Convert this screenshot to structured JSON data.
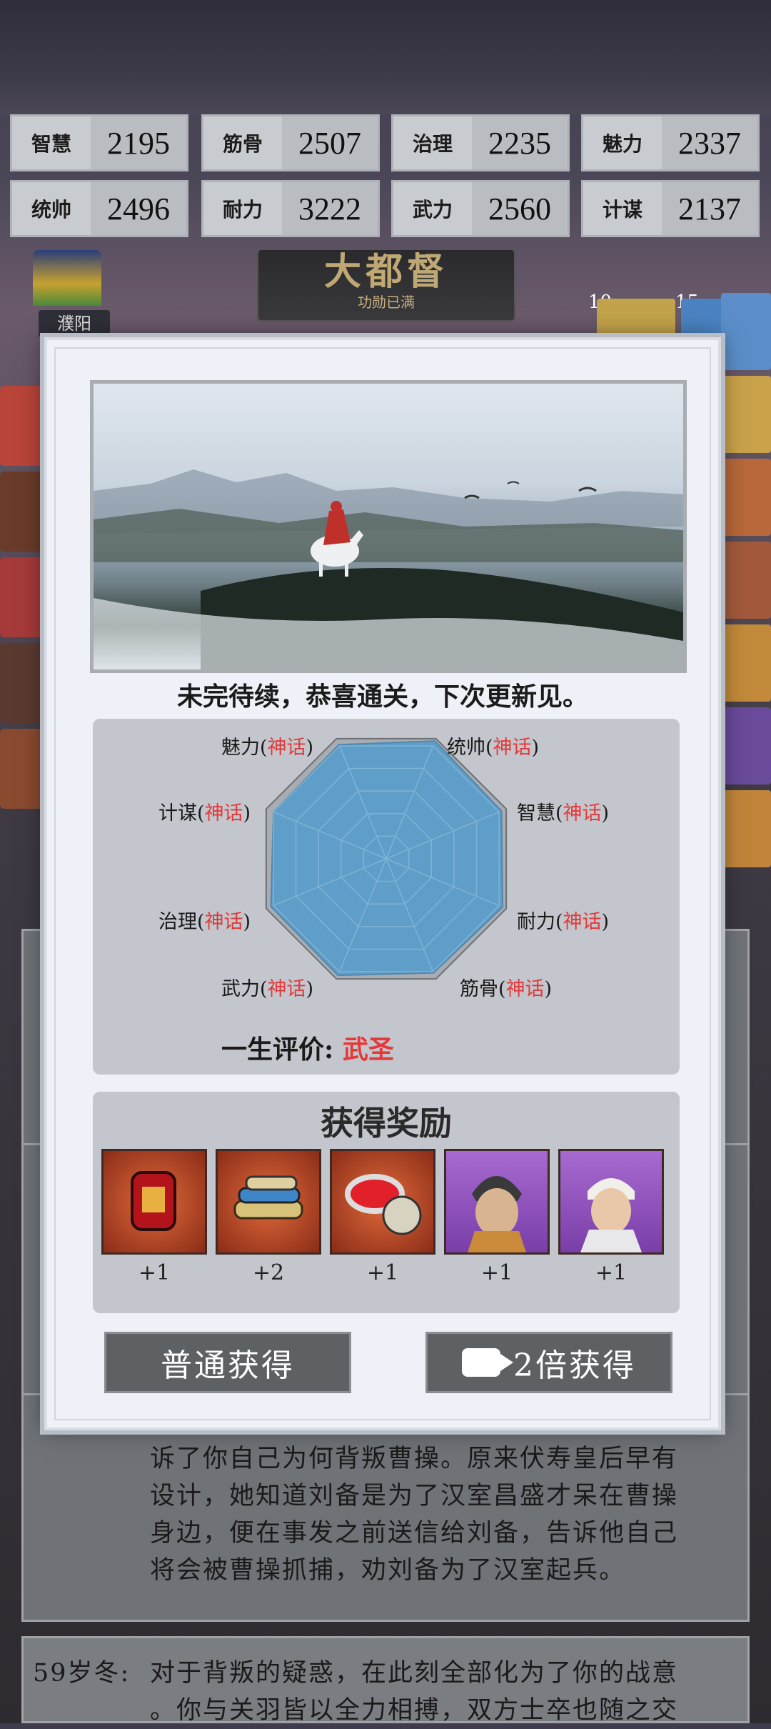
{
  "stats": [
    {
      "label": "智慧",
      "value": "2195"
    },
    {
      "label": "筋骨",
      "value": "2507"
    },
    {
      "label": "治理",
      "value": "2235"
    },
    {
      "label": "魅力",
      "value": "2337"
    },
    {
      "label": "统帅",
      "value": "2496"
    },
    {
      "label": "耐力",
      "value": "3222"
    },
    {
      "label": "武力",
      "value": "2560"
    },
    {
      "label": "计谋",
      "value": "2137"
    }
  ],
  "title": {
    "rank": "大都督",
    "status": "功勋已满"
  },
  "city": {
    "name": "濮阳"
  },
  "side_numbers": {
    "a": "10",
    "b": "15"
  },
  "modal": {
    "caption": "未完待续，恭喜通关，下次更新见。",
    "radar": {
      "labels": [
        {
          "name": "统帅",
          "level": "神话"
        },
        {
          "name": "智慧",
          "level": "神话"
        },
        {
          "name": "耐力",
          "level": "神话"
        },
        {
          "name": "筋骨",
          "level": "神话"
        },
        {
          "name": "武力",
          "level": "神话"
        },
        {
          "name": "治理",
          "level": "神话"
        },
        {
          "name": "计谋",
          "level": "神话"
        },
        {
          "name": "魅力",
          "level": "神话"
        }
      ],
      "values": [
        0.98,
        0.96,
        0.97,
        0.95,
        0.97,
        0.96,
        0.94,
        0.95
      ]
    },
    "evaluation": {
      "label": "一生评价:",
      "value": "武圣"
    },
    "rewards": {
      "title": "获得奖励",
      "items": [
        {
          "icon": "lantern-pouch-icon",
          "qty": "+1"
        },
        {
          "icon": "scrolls-icon",
          "qty": "+2"
        },
        {
          "icon": "seal-paste-icon",
          "qty": "+1"
        },
        {
          "icon": "general-portrait-helmet",
          "qty": "+1"
        },
        {
          "icon": "general-portrait-white",
          "qty": "+1"
        }
      ]
    },
    "buttons": {
      "normal": "普通获得",
      "double": "2倍获得"
    }
  },
  "log": {
    "entry1": "诉了你自己为何背叛曹操。原来伏寿皇后早有设计，她知道刘备是为了汉室昌盛才呆在曹操身边，便在事发之前送信给刘备，告诉他自己将会被曹操抓捕，劝刘备为了汉室起兵。",
    "entry1_lines": [
      "诉了你自己为何背叛曹操。原来伏寿皇后早有",
      "设计，她知道刘备是为了汉室昌盛才呆在曹操",
      "身边，便在事发之前送信给刘备，告诉他自己",
      "将会被曹操抓捕，劝刘备为了汉室起兵。"
    ],
    "entry2_age": "59岁冬:",
    "entry2_lines": [
      "对于背叛的疑惑，在此刻全部化为了你的战意",
      "。你与关羽皆以全力相搏，双方士卒也随之交"
    ]
  }
}
